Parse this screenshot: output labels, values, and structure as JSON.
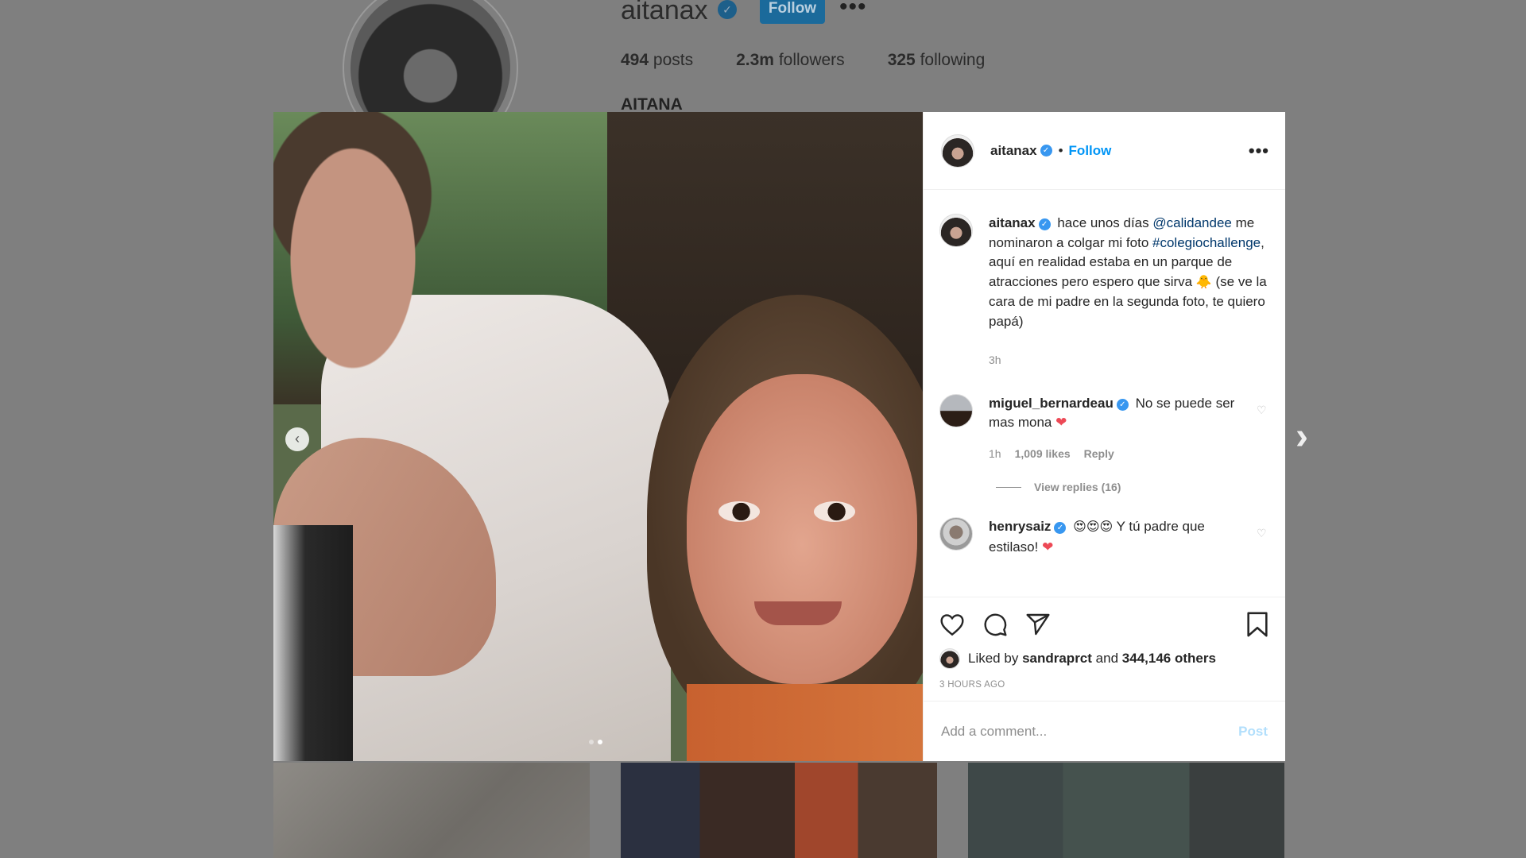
{
  "profile": {
    "username": "aitanax",
    "follow_label": "Follow",
    "more_label": "•••",
    "posts_count": "494",
    "posts_label": "posts",
    "followers_count": "2.3m",
    "followers_label": "followers",
    "following_count": "325",
    "following_label": "following",
    "full_name": "AITANA"
  },
  "post": {
    "header": {
      "username": "aitanax",
      "separator": "•",
      "follow_label": "Follow",
      "more_label": "•••"
    },
    "caption": {
      "username": "aitanax",
      "text_1": "hace unos días",
      "mention": "@calidandee",
      "text_2": "me nominaron a colgar mi foto",
      "hashtag": "#colegiochallenge",
      "text_3": ", aquí en realidad estaba en un parque de atracciones pero espero que sirva",
      "emoji": "🐥",
      "text_4": "(se ve la cara de mi padre en la segunda foto, te quiero papá)",
      "time": "3h"
    },
    "comments": [
      {
        "username": "miguel_bernardeau",
        "text": "No se puede ser mas mona",
        "emoji": "❤",
        "time": "1h",
        "likes": "1,009 likes",
        "reply_label": "Reply",
        "view_replies": "View replies (16)"
      },
      {
        "username": "henrysaiz",
        "emojis": "😍😍😍",
        "text": "Y tú padre que estilaso!",
        "emoji": "❤"
      }
    ],
    "likes": {
      "prefix": "Liked by",
      "user": "sandraprct",
      "conj": "and",
      "others": "344,146 others"
    },
    "timestamp": "3 HOURS AGO",
    "add_comment_placeholder": "Add a comment...",
    "post_label": "Post",
    "carousel": {
      "current": 2,
      "total": 2
    }
  },
  "icons": {
    "verified": "verified-badge-icon",
    "like": "heart-icon",
    "comment": "comment-bubble-icon",
    "share": "paper-plane-icon",
    "save": "bookmark-icon",
    "prev": "chevron-left-icon",
    "next": "chevron-right-icon"
  },
  "colors": {
    "link_blue": "#0095f6",
    "mention_blue": "#00376b",
    "muted": "#8e8e8e",
    "post_disabled": "#b2dffc",
    "heart_red": "#ed4956"
  }
}
